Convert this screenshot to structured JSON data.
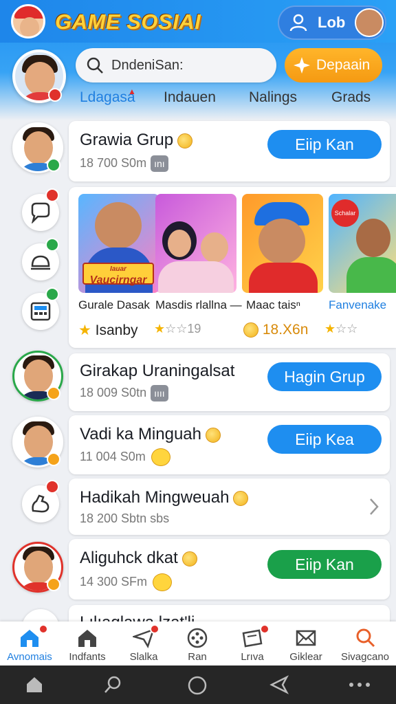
{
  "header": {
    "app_title": "GAME SOSIAI",
    "profile_label": "Lob",
    "search_text": "DndeniSan:",
    "deposit_label": "Depaain"
  },
  "tabs": [
    "Ldagasa",
    "Indauen",
    "Nalings",
    "Grads"
  ],
  "cards": [
    {
      "title": "Grawia Grup",
      "meta": "18 700 S0m",
      "tag": "ını",
      "button": "Eiip Kan"
    },
    {
      "title": "Girakap Uraningalsat",
      "meta": "18 009 S0tn",
      "tag": "ıııı",
      "button": "Hagin Grup"
    },
    {
      "title": "Vadi ka Minguah",
      "meta": "11 004 S0m",
      "button": "Eiip Kea"
    },
    {
      "title": "Hadikah Mingweuah",
      "meta": "18 200 Sbtn sbs"
    },
    {
      "title": "Aliguhck dkat",
      "meta": "14 300 SFm",
      "button": "Eiip Kan"
    },
    {
      "title": "Lılıaglawa lzat'li"
    }
  ],
  "games": [
    {
      "name": "Gurale Dasak",
      "stat": "Isanby",
      "banner": "Vaucirngar",
      "banner_top": "Iauar"
    },
    {
      "name": "Masdis rlallna —",
      "stat": "☆☆19"
    },
    {
      "name": "Maac taisⁿ",
      "stat": "18.X6n"
    },
    {
      "name": "Fanvenake",
      "stat": "☆☆",
      "banner": "Schalar"
    }
  ],
  "bottom_nav": [
    "Avnomais",
    "Indfants",
    "Slalka",
    "Ran",
    "Lrıva",
    "Giklear",
    "Sivagcano"
  ],
  "colors": {
    "primary": "#1e8ef0",
    "accent": "#f59a12",
    "success": "#1aa04a",
    "alert": "#e0322b"
  }
}
